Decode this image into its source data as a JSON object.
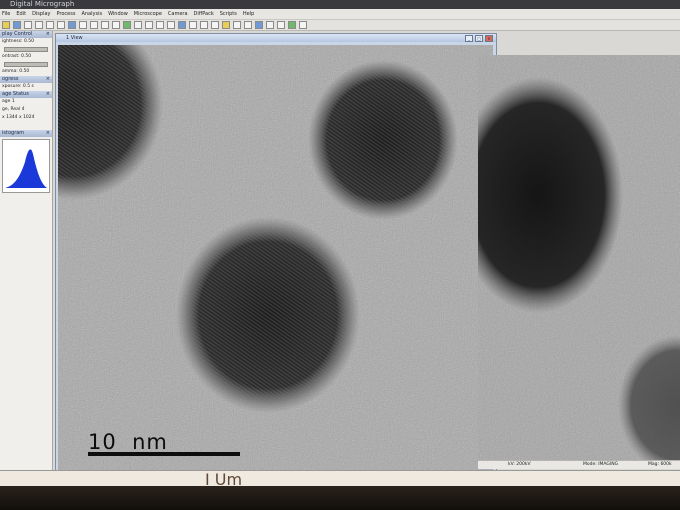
{
  "app": {
    "title": "Digital Micrograph"
  },
  "menu": [
    "File",
    "Edit",
    "Display",
    "Process",
    "Analysis",
    "Window",
    "Microscope",
    "Camera",
    "DiffPack",
    "Scripts",
    "Help"
  ],
  "sidebar": {
    "display_control": {
      "title": "play Control",
      "brightness": "ightness: 0.50",
      "contrast": "ontrast: 0.50",
      "gamma": "amma: 0.50"
    },
    "progress": {
      "title": "ogress",
      "exposure": "xposure: 0.5 s"
    },
    "image_status": {
      "title": "age Status",
      "line1": "age 1",
      "line2": "ge, Real 4",
      "line3": "x 1344 x 1024"
    },
    "histogram": {
      "title": "istogram"
    }
  },
  "image_window": {
    "title": "1 View"
  },
  "scale_bar": {
    "value": "10",
    "unit": "nm"
  },
  "status_bar": {
    "voltage": "kV: 200kV",
    "mode": "Mode: IMAGING",
    "mag": "Mag: 600k"
  },
  "ruler_text": "I  Um",
  "colors": {
    "histogram_fill": "#1a39d8",
    "window_head": "#b4c6e0"
  }
}
